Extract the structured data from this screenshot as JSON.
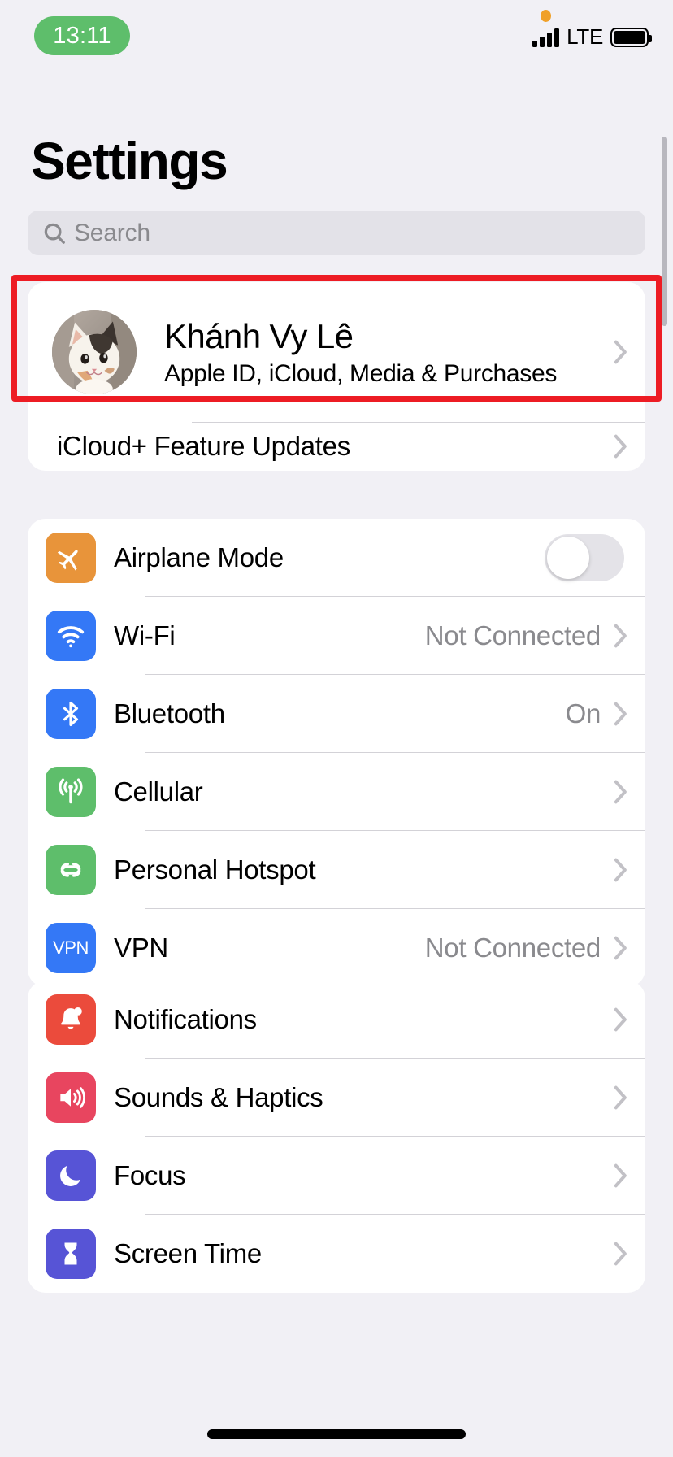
{
  "status_bar": {
    "time": "13:11",
    "time_pill_color": "#5EBE6B",
    "carrier_network": "LTE",
    "privacy_indicator": "microphone-in-use",
    "privacy_indicator_color": "#F0A028",
    "signal_bars": 4,
    "battery_level_percent": 100
  },
  "header": {
    "title": "Settings"
  },
  "search": {
    "placeholder": "Search",
    "value": ""
  },
  "account": {
    "name": "Khánh Vy Lê",
    "subtitle": "Apple ID, iCloud, Media & Purchases",
    "avatar_description": "cat-photo",
    "highlighted": true,
    "highlight_color": "#ED1C24"
  },
  "icloud_updates": {
    "label": "iCloud+ Feature Updates"
  },
  "groups": [
    {
      "id": "connectivity",
      "rows": [
        {
          "label": "Airplane Mode",
          "icon": "airplane-icon",
          "icon_color": "#E8943A",
          "control": "toggle",
          "toggle_on": false,
          "value": ""
        },
        {
          "label": "Wi-Fi",
          "icon": "wifi-icon",
          "icon_color": "#3478F6",
          "control": "chevron",
          "value": "Not Connected"
        },
        {
          "label": "Bluetooth",
          "icon": "bluetooth-icon",
          "icon_color": "#3478F6",
          "control": "chevron",
          "value": "On"
        },
        {
          "label": "Cellular",
          "icon": "cellular-antenna-icon",
          "icon_color": "#5EBE6B",
          "control": "chevron",
          "value": ""
        },
        {
          "label": "Personal Hotspot",
          "icon": "hotspot-link-icon",
          "icon_color": "#5EBE6B",
          "control": "chevron",
          "value": ""
        },
        {
          "label": "VPN",
          "icon": "vpn-icon",
          "icon_color": "#3478F6",
          "control": "chevron",
          "value": "Not Connected"
        }
      ]
    },
    {
      "id": "alerts",
      "rows": [
        {
          "label": "Notifications",
          "icon": "bell-icon",
          "icon_color": "#EB4B3C",
          "control": "chevron",
          "value": ""
        },
        {
          "label": "Sounds & Haptics",
          "icon": "speaker-icon",
          "icon_color": "#E8455F",
          "control": "chevron",
          "value": ""
        },
        {
          "label": "Focus",
          "icon": "moon-icon",
          "icon_color": "#5754D6",
          "control": "chevron",
          "value": ""
        },
        {
          "label": "Screen Time",
          "icon": "hourglass-icon",
          "icon_color": "#5754D6",
          "control": "chevron",
          "value": ""
        }
      ]
    }
  ],
  "theme": {
    "background": "#F1F0F5",
    "card_background": "#FFFFFF",
    "separator": "#D3D2D7",
    "secondary_text": "#8A8A8E"
  }
}
